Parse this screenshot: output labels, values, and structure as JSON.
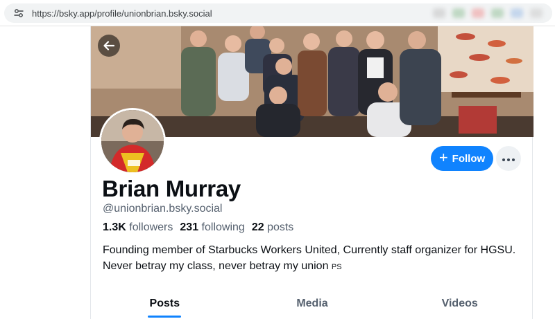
{
  "browser": {
    "url": "https://bsky.app/profile/unionbrian.bsky.social",
    "site_info_icon": "tune-icon"
  },
  "profile": {
    "display_name": "Brian Murray",
    "handle": "@unionbrian.bsky.social",
    "followers_count": "1.3K",
    "followers_label": "followers",
    "following_count": "231",
    "following_label": "following",
    "posts_count": "22",
    "posts_label": "posts",
    "bio_text": "Founding member of Starbucks Workers United, Currently staff organizer for HGSU. Never betray my class, never betray my union",
    "bio_suffix": "PS"
  },
  "actions": {
    "follow_label": "Follow",
    "follow_icon": "plus-icon",
    "more_icon": "ellipsis-icon",
    "back_icon": "arrow-left-icon"
  },
  "tabs": [
    {
      "label": "Posts",
      "active": true
    },
    {
      "label": "Media",
      "active": false
    },
    {
      "label": "Videos",
      "active": false
    }
  ],
  "colors": {
    "accent": "#1083fe",
    "text_primary": "#0b0f14",
    "text_secondary": "#55606e"
  }
}
